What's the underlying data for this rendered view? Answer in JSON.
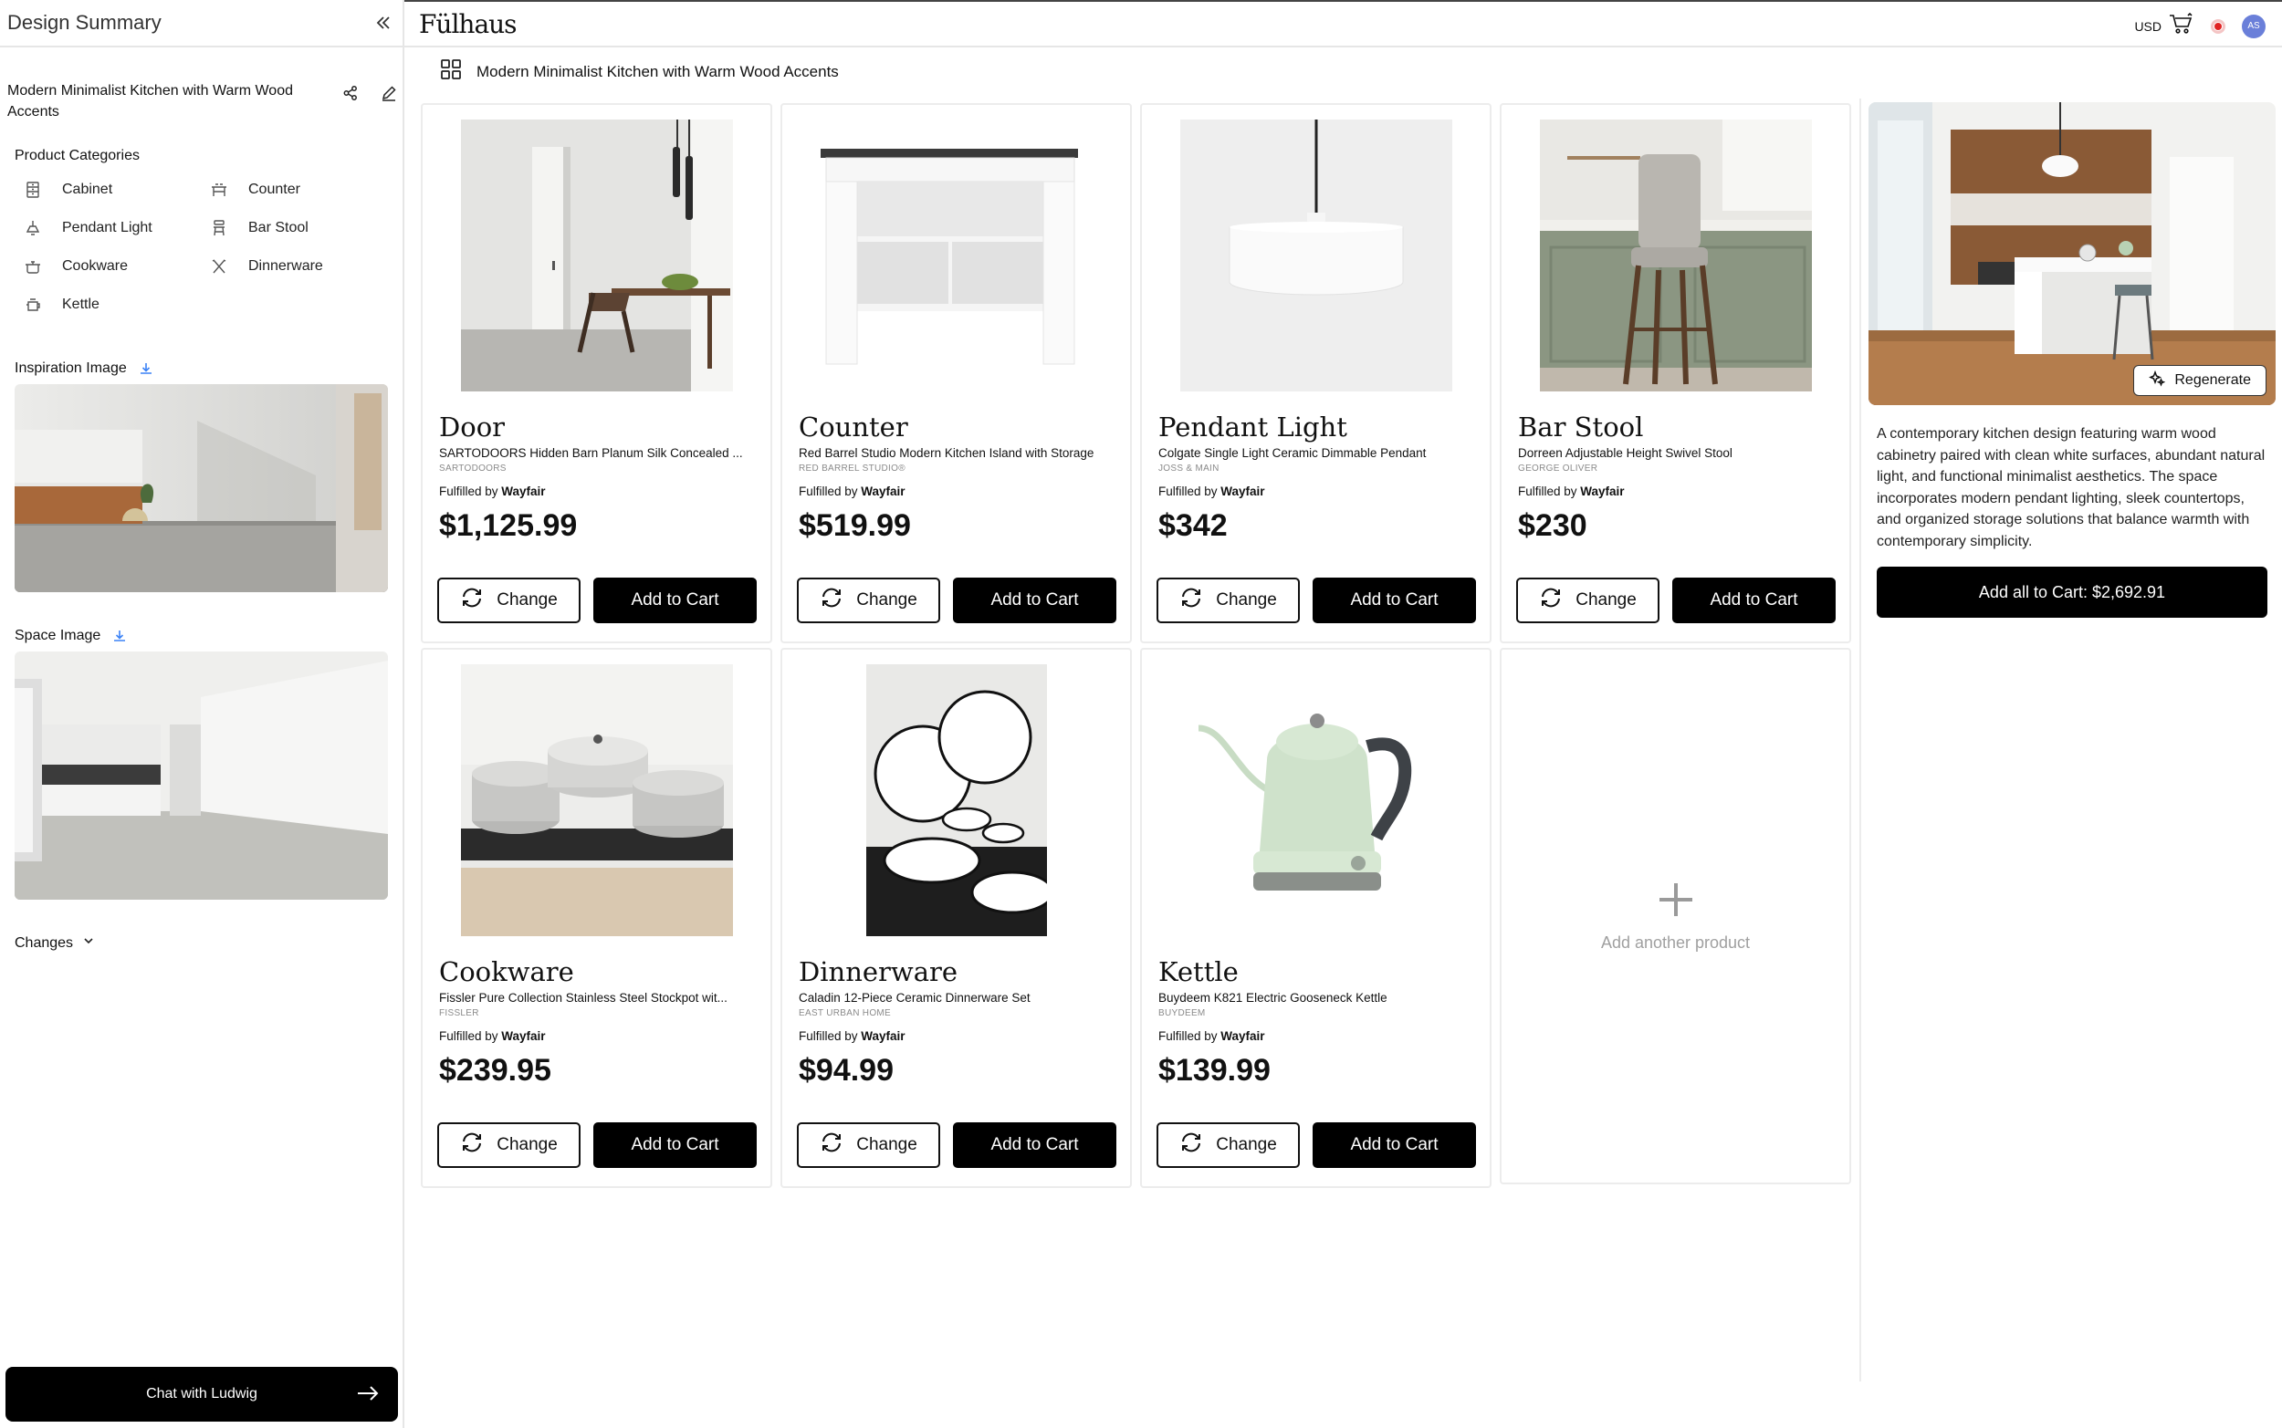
{
  "sidebar": {
    "title": "Design Summary",
    "design_name": "Modern Minimalist Kitchen with Warm Wood Accents",
    "product_categories_label": "Product Categories",
    "categories": [
      {
        "label": "Cabinet",
        "icon": "cabinet-icon"
      },
      {
        "label": "Counter",
        "icon": "counter-icon"
      },
      {
        "label": "Pendant Light",
        "icon": "pendant-light-icon"
      },
      {
        "label": "Bar Stool",
        "icon": "bar-stool-icon"
      },
      {
        "label": "Cookware",
        "icon": "cookware-icon"
      },
      {
        "label": "Dinnerware",
        "icon": "dinnerware-icon"
      },
      {
        "label": "Kettle",
        "icon": "kettle-icon"
      }
    ],
    "inspiration_label": "Inspiration Image",
    "space_label": "Space Image",
    "changes_label": "Changes",
    "chat_label": "Chat with Ludwig"
  },
  "topbar": {
    "brand": "Fülhaus",
    "currency": "USD",
    "avatar_initials": "AS"
  },
  "main": {
    "design_title": "Modern Minimalist Kitchen with Warm Wood Accents",
    "fulfilled_prefix": "Fulfilled by",
    "change_label": "Change",
    "add_to_cart_label": "Add to Cart",
    "add_product_label": "Add another product",
    "products": [
      {
        "category": "Door",
        "name": "SARTODOORS Hidden Barn Planum Silk Concealed ...",
        "brand": "SARTODOORS",
        "vendor": "Wayfair",
        "price": "$1,125.99"
      },
      {
        "category": "Counter",
        "name": "Red Barrel Studio Modern Kitchen Island with Storage",
        "brand": "RED BARREL STUDIO®",
        "vendor": "Wayfair",
        "price": "$519.99"
      },
      {
        "category": "Pendant Light",
        "name": "Colgate Single Light Ceramic Dimmable Pendant",
        "brand": "JOSS & MAIN",
        "vendor": "Wayfair",
        "price": "$342"
      },
      {
        "category": "Bar Stool",
        "name": "Dorreen Adjustable Height Swivel Stool",
        "brand": "GEORGE OLIVER",
        "vendor": "Wayfair",
        "price": "$230"
      },
      {
        "category": "Cookware",
        "name": "Fissler Pure Collection Stainless Steel Stockpot wit...",
        "brand": "FISSLER",
        "vendor": "Wayfair",
        "price": "$239.95"
      },
      {
        "category": "Dinnerware",
        "name": "Caladin 12-Piece Ceramic Dinnerware Set",
        "brand": "EAST URBAN HOME",
        "vendor": "Wayfair",
        "price": "$94.99"
      },
      {
        "category": "Kettle",
        "name": "Buydeem K821 Electric Gooseneck Kettle",
        "brand": "BUYDEEM",
        "vendor": "Wayfair",
        "price": "$139.99"
      }
    ]
  },
  "summary": {
    "regenerate_label": "Regenerate",
    "description": "A contemporary kitchen design featuring warm wood cabinetry paired with clean white surfaces, abundant natural light, and functional minimalist aesthetics. The space incorporates modern pendant lighting, sleek countertops, and organized storage solutions that balance warmth with contemporary simplicity.",
    "add_all_label": "Add all to Cart: $2,692.91"
  },
  "colors": {
    "accent": "#000000",
    "avatar": "#6a7fd9",
    "record": "#e02424",
    "border": "#ececec"
  }
}
